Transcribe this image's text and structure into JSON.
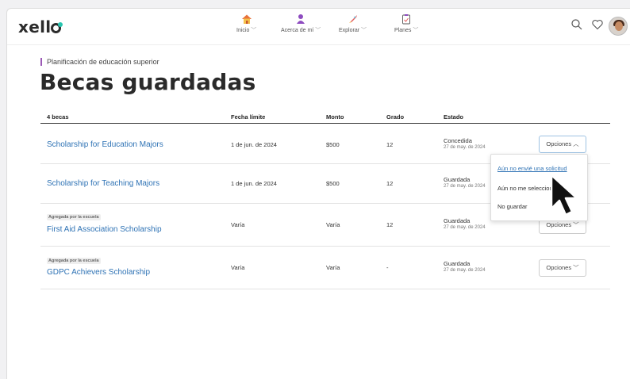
{
  "brand": {
    "logo_text": "xell",
    "logo_accent": "#29c5b0"
  },
  "nav": {
    "items": [
      {
        "label": "Inicio",
        "icon": "house-icon"
      },
      {
        "label": "Acerca de mí",
        "icon": "person-icon"
      },
      {
        "label": "Explorar",
        "icon": "rocket-icon"
      },
      {
        "label": "Planes",
        "icon": "clipboard-icon"
      }
    ],
    "utilities": [
      "search-icon",
      "heart-icon",
      "avatar"
    ]
  },
  "page": {
    "eyebrow": "Planificación de educación superior",
    "title": "Becas guardadas",
    "accent": "#9b59b6"
  },
  "table": {
    "headers": {
      "count": "4 becas",
      "deadline": "Fecha límite",
      "amount": "Monto",
      "grade": "Grado",
      "status": "Estado"
    },
    "rows": [
      {
        "tag": "",
        "name": "Scholarship for Education Majors",
        "deadline": "1 de jun. de 2024",
        "amount": "$500",
        "grade": "12",
        "status": "Concedida",
        "status_date": "27 de may. de 2024",
        "options": "Opciones"
      },
      {
        "tag": "",
        "name": "Scholarship for Teaching Majors",
        "deadline": "1 de jun. de 2024",
        "amount": "$500",
        "grade": "12",
        "status": "Guardada",
        "status_date": "27 de may. de 2024",
        "options": "Opciones"
      },
      {
        "tag": "Agregada por la escuela",
        "name": "First Aid Association Scholarship",
        "deadline": "Varía",
        "amount": "Varía",
        "grade": "12",
        "status": "Guardada",
        "status_date": "27 de may. de 2024",
        "options": "Opciones"
      },
      {
        "tag": "Agregada por la escuela",
        "name": "GDPC Achievers Scholarship",
        "deadline": "Varía",
        "amount": "Varía",
        "grade": "-",
        "status": "Guardada",
        "status_date": "27 de may. de 2024",
        "options": "Opciones"
      }
    ]
  },
  "dropdown": {
    "items": [
      "Aún no envié una solicitud",
      "Aún no me seleccionaron",
      "No guardar"
    ]
  },
  "colors": {
    "link": "#2f73b5",
    "button_border": "#9ec3e3"
  }
}
